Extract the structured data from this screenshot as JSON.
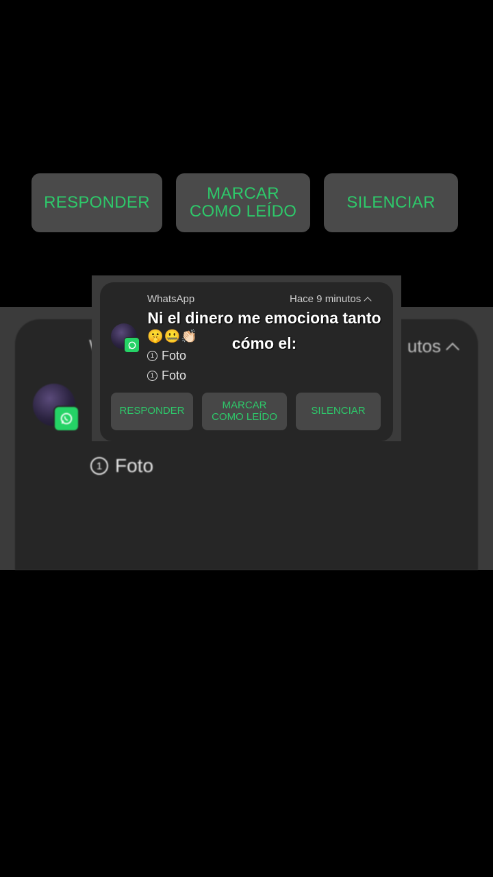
{
  "caption": {
    "line1": "Ni el dinero me emociona tanto",
    "line2": "cómo el:"
  },
  "notification": {
    "app_name": "WhatsApp",
    "time": "Hace 9 minutos",
    "emojis": "🤫🤐👏🏻",
    "messages": [
      {
        "icon": "①",
        "text": "Foto"
      },
      {
        "icon": "①",
        "text": "Foto"
      }
    ],
    "actions": {
      "reply": "RESPONDER",
      "mark_read_line1": "MARCAR",
      "mark_read_line2": "COMO LEÍDO",
      "mute": "SILENCIAR"
    }
  },
  "background_notification": {
    "app_fragment": "W",
    "time_fragment": "utos",
    "messages": [
      {
        "icon": "①",
        "text": "Foto"
      }
    ],
    "actions": {
      "reply": "RESPONDER",
      "mark_read_line1": "MARCAR",
      "mark_read_line2": "COMO LEÍDO",
      "mute": "SILENCIAR"
    }
  },
  "colors": {
    "background": "#000000",
    "card": "#262626",
    "button": "#474747",
    "accent_green": "#2ec86a",
    "whatsapp_green": "#25d366"
  },
  "icons": [
    "whatsapp-icon",
    "chevron-up-icon",
    "contact-avatar"
  ]
}
